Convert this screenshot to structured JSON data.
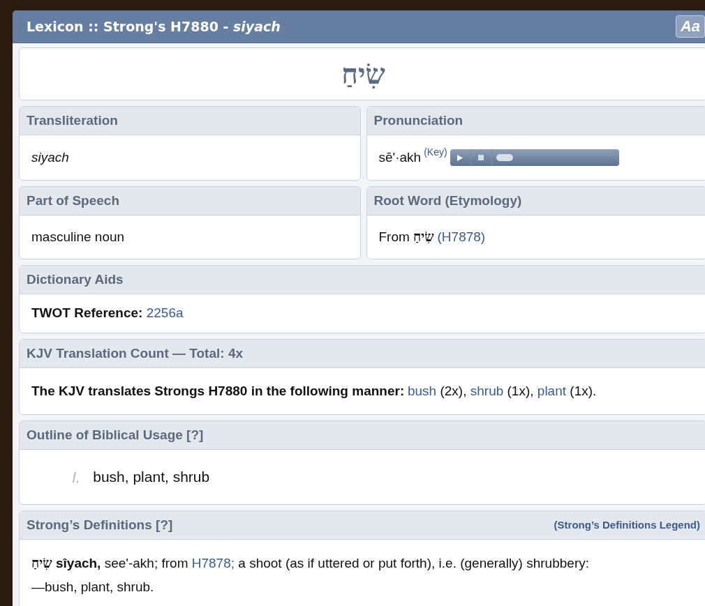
{
  "window": {
    "title": "Lexicon :: Strong's H7880 - ",
    "title_word": "siyach",
    "font_button": "Aa"
  },
  "headword": "שִׂיחַ",
  "transliteration": {
    "heading": "Transliteration",
    "value": "siyach"
  },
  "pronunciation": {
    "heading": "Pronunciation",
    "value": "sē'·akh",
    "key_link": "(Key)"
  },
  "part_of_speech": {
    "heading": "Part of Speech",
    "value": "masculine noun"
  },
  "root_word": {
    "heading": "Root Word (Etymology)",
    "segments": [
      {
        "kind": "plain",
        "text": "From "
      },
      {
        "kind": "hebrew",
        "text": "שִׂיחַ"
      },
      {
        "kind": "link",
        "text": "(H7878)"
      }
    ]
  },
  "dictionary_aids": {
    "heading": "Dictionary Aids",
    "label": "TWOT Reference:",
    "link": "2256a"
  },
  "kjv_count": {
    "heading": "KJV Translation Count — Total: 4x",
    "segments": [
      {
        "kind": "bold",
        "text": "The KJV translates Strongs H7880 in the following manner:"
      },
      {
        "kind": "link",
        "text": "bush"
      },
      {
        "kind": "plain",
        "text": " (2x), "
      },
      {
        "kind": "link",
        "text": "shrub"
      },
      {
        "kind": "plain",
        "text": " (1x), "
      },
      {
        "kind": "link",
        "text": "plant"
      },
      {
        "kind": "plain",
        "text": " (1x)."
      }
    ]
  },
  "outline": {
    "heading": "Outline of Biblical Usage [?]",
    "items": [
      {
        "marker": "I.",
        "text": "bush, plant, shrub"
      }
    ]
  },
  "strongs": {
    "heading": "Strong’s Definitions [?]",
    "legend_link": "(Strong’s Definitions Legend)",
    "segments": [
      {
        "kind": "hebrew",
        "text": "שִׂיחַ"
      },
      {
        "kind": "bold",
        "text": " sîyach,"
      },
      {
        "kind": "plain",
        "text": " see'-akh; from "
      },
      {
        "kind": "link",
        "text": "H7878;"
      },
      {
        "kind": "plain",
        "text": " a shoot (as if uttered or put forth), i.e. (generally) shrubbery: "
      },
      {
        "kind": "unbroken",
        "text": "—bush, plant, shrub."
      }
    ]
  }
}
